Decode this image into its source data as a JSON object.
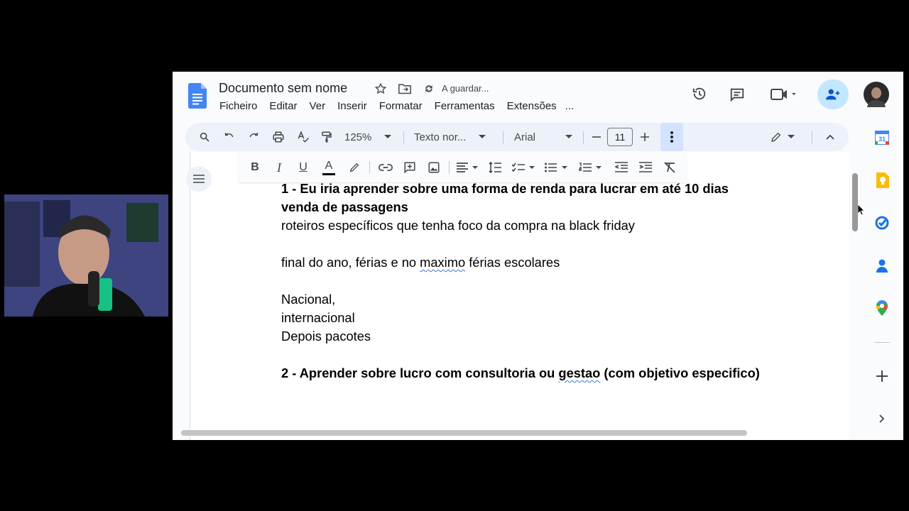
{
  "document": {
    "title": "Documento sem nome",
    "status": "A guardar..."
  },
  "menu": [
    "Ficheiro",
    "Editar",
    "Ver",
    "Inserir",
    "Formatar",
    "Ferramentas",
    "Extensões",
    "..."
  ],
  "toolbar": {
    "zoom": "125%",
    "style": "Texto nor...",
    "font": "Arial",
    "font_size": "11"
  },
  "formatting": {
    "bold": "B",
    "italic": "I",
    "underline": "U",
    "text_color": "A"
  },
  "body": {
    "line1": "1 - Eu iria aprender sobre uma forma de renda para lucrar em até 10 dias",
    "line2": "venda de passagens",
    "line3": "roteiros específicos que tenha foco da compra na black friday",
    "line4_a": "final do ano, férias e no ",
    "line4_b": "maximo",
    "line4_c": " férias escolares",
    "line5": "Nacional,",
    "line6": "internacional",
    "line7": "Depois pacotes",
    "line8_a": "2 - Aprender sobre lucro com consultoria ou ",
    "line8_b": "gestao",
    "line8_c": " (com objetivo especifico)"
  },
  "side_panel": {
    "calendar_day": "31"
  },
  "colors": {
    "docs_blue": "#4285f4",
    "share_bg": "#c2e7ff",
    "keep_yellow": "#fbbc04",
    "tasks_blue": "#1a73e8"
  }
}
